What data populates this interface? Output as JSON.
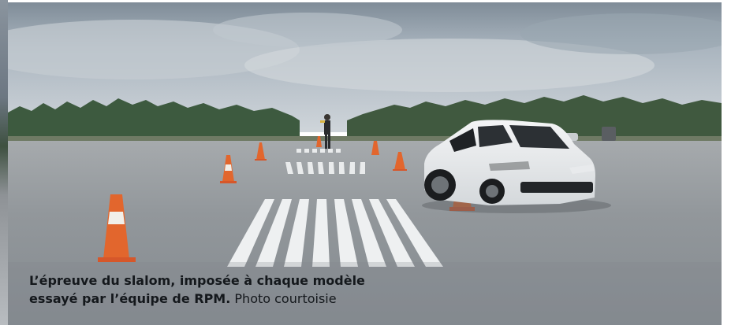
{
  "caption": {
    "bold_line_1": "L’épreuve du slalom, imposée à chaque modèle",
    "bold_line_2": "essayé par l’équipe de RPM.",
    "credit": "Photo courtoisie"
  },
  "scene": {
    "subjects": [
      "sky",
      "tree-line",
      "runway",
      "traffic-cones",
      "runway-stripes",
      "white-crossover-car",
      "flag-person"
    ],
    "colors": {
      "sky": "#b9c3cb",
      "asphalt": "#8d9296",
      "cone_orange": "#e2662d",
      "car": "#eef0f1",
      "trees": "#3f5a40"
    }
  }
}
